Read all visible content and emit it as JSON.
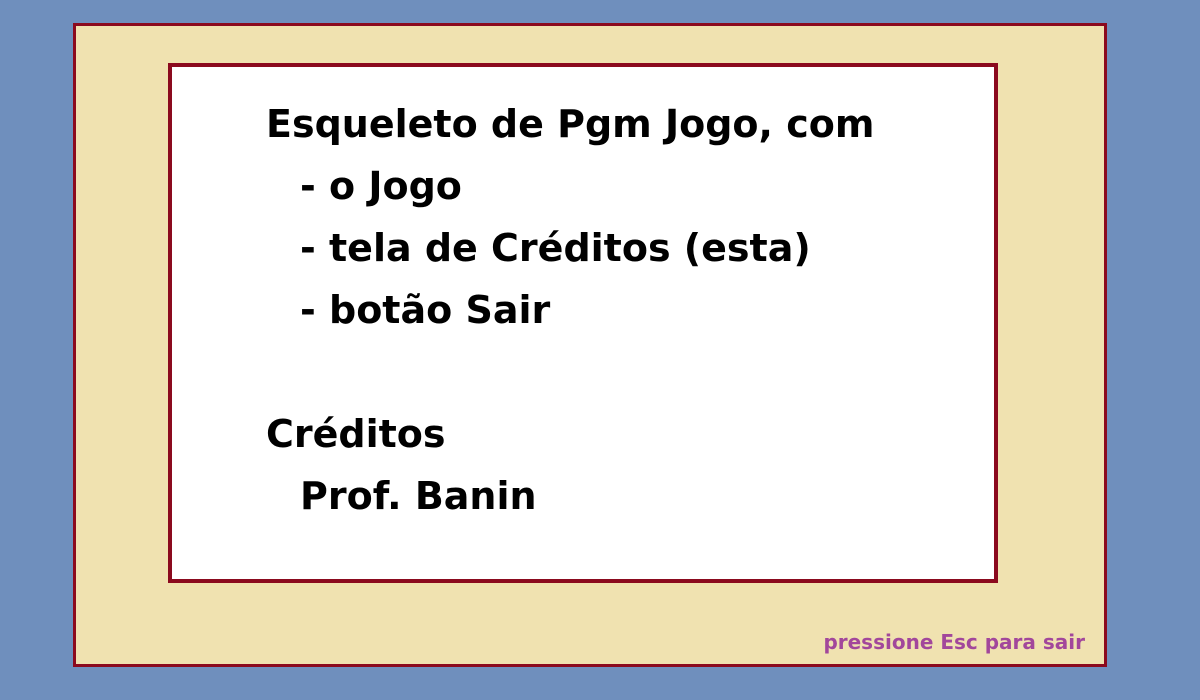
{
  "credits_screen": {
    "heading": "Esqueleto de Pgm Jogo, com",
    "features": [
      "- o Jogo",
      "- tela de Créditos (esta)",
      "- botão Sair"
    ],
    "credits_title": "Créditos",
    "credits_author": "Prof. Banin"
  },
  "footer": {
    "hint": "pressione Esc para sair"
  },
  "colors": {
    "background": "#6f8fbd",
    "frame_fill": "#f0e2b0",
    "frame_border": "#8b0a1e",
    "panel_fill": "#ffffff",
    "hint_text": "#a2479b"
  }
}
